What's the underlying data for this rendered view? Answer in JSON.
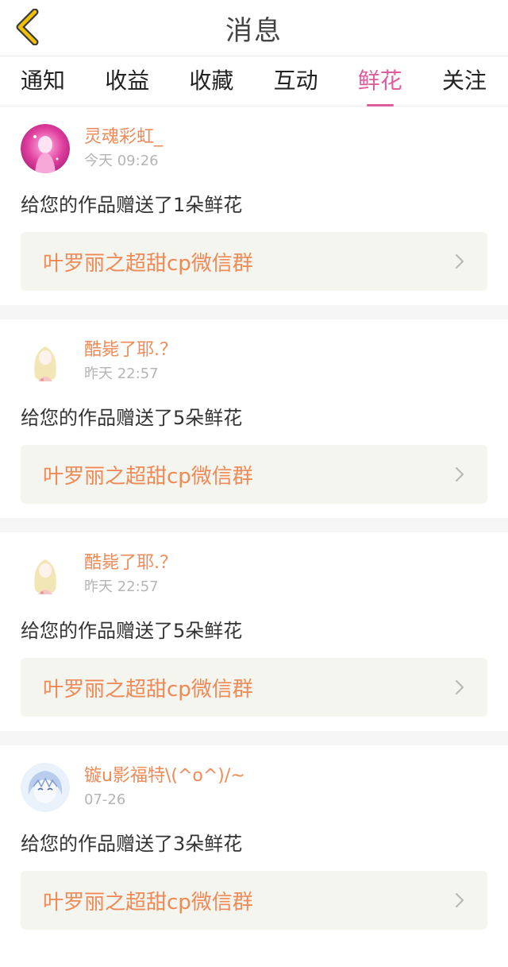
{
  "header": {
    "title": "消息",
    "back_icon": "chevron-left-icon",
    "accent_color": "#f2c200"
  },
  "tabs": [
    {
      "label": "通知",
      "active": false
    },
    {
      "label": "收益",
      "active": false
    },
    {
      "label": "收藏",
      "active": false
    },
    {
      "label": "互动",
      "active": false
    },
    {
      "label": "鲜花",
      "active": true
    },
    {
      "label": "关注",
      "active": false
    }
  ],
  "colors": {
    "active_tab": "#e05d9c",
    "username": "#ef8a57",
    "link_bg": "#f5f5f0"
  },
  "messages": [
    {
      "username": "灵魂彩虹_",
      "time": "今天 09:26",
      "text": "给您的作品赠送了1朵鲜花",
      "work": "叶罗丽之超甜cp微信群",
      "avatar": "pink-avatar"
    },
    {
      "username": "酷毙了耶.？",
      "time": "昨天 22:57",
      "text": "给您的作品赠送了5朵鲜花",
      "work": "叶罗丽之超甜cp微信群",
      "avatar": "blonde-doll-avatar"
    },
    {
      "username": "酷毙了耶.？",
      "time": "昨天 22:57",
      "text": "给您的作品赠送了5朵鲜花",
      "work": "叶罗丽之超甜cp微信群",
      "avatar": "blonde-doll-avatar"
    },
    {
      "username": "镟u影福特\\(^o^)/~",
      "time": "07-26",
      "text": "给您的作品赠送了3朵鲜花",
      "work": "叶罗丽之超甜cp微信群",
      "avatar": "blue-anime-avatar"
    }
  ]
}
